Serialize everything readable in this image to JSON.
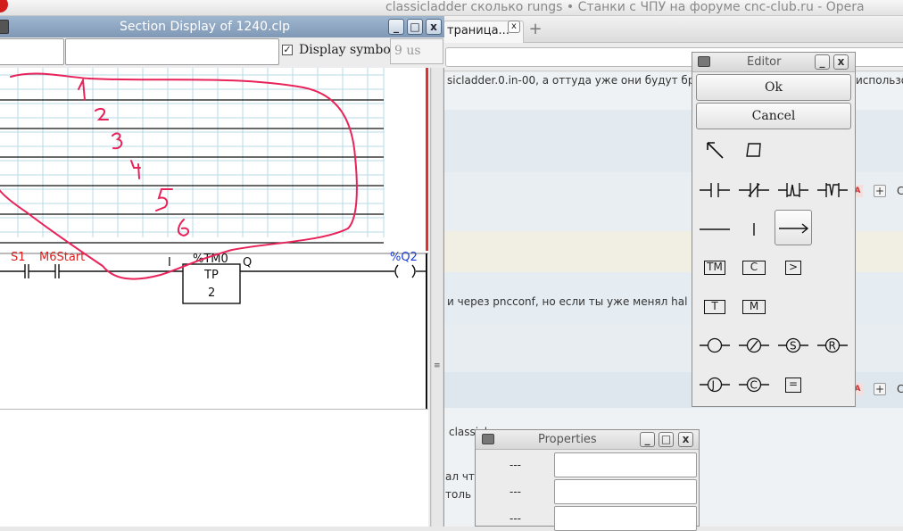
{
  "browser": {
    "window_title": "classicladder сколько rungs • Станки с ЧПУ на форуме cnc-club.ru - Opera",
    "tab_label": "траница...",
    "tab_close": "x",
    "new_tab": "+"
  },
  "forum": {
    "line1": "sicladder.0.in-00, а оттуда уже они будут браться",
    "line2": "использов",
    "line3": "и через pncconf, но если ты уже менял hal вр",
    "line4": "classicl",
    "line5": "ал что",
    "line6": "толь",
    "btn_plus": "+",
    "btn_a": "A",
    "edge_char": "C"
  },
  "section_display": {
    "title": "Section Display of 1240.clp",
    "display_symbols_label": "Display symbols",
    "display_symbols_checked": true,
    "check_mark": "✓",
    "time_value": "9 us",
    "btn_minimize": "_",
    "btn_maximize": "□",
    "btn_close": "x",
    "scroll_grip": "≡",
    "ladder": {
      "contact1_label": "S1",
      "contact2_label": "M6Start",
      "timer_var": "%TM0",
      "timer_type": "TP",
      "timer_value": "2",
      "input_pin": "I",
      "output_pin": "Q",
      "coil_label": "%Q2",
      "label_color": "#e02020",
      "coil_color": "#1a3cd8"
    },
    "annotation_numbers": [
      "1",
      "2",
      "3",
      "4",
      "5",
      "6"
    ],
    "annotation_color": "#e8235a"
  },
  "editor": {
    "title": "Editor",
    "ok_label": "Ok",
    "cancel_label": "Cancel",
    "btn_minimize": "_",
    "btn_close": "x",
    "tools": {
      "timer_label": "TM",
      "counter_label": "C",
      "compare_label": ">",
      "old_timer_label": "T",
      "monostable_label": "M",
      "set_label": "S",
      "reset_label": "R",
      "jump_label": "J",
      "call_label": "C",
      "operate_label": "="
    }
  },
  "properties": {
    "title": "Properties",
    "btn_minimize": "_",
    "btn_maximize": "□",
    "btn_close": "x",
    "rows": [
      {
        "label": "---",
        "value": ""
      },
      {
        "label": "---",
        "value": ""
      },
      {
        "label": "---",
        "value": ""
      }
    ]
  }
}
